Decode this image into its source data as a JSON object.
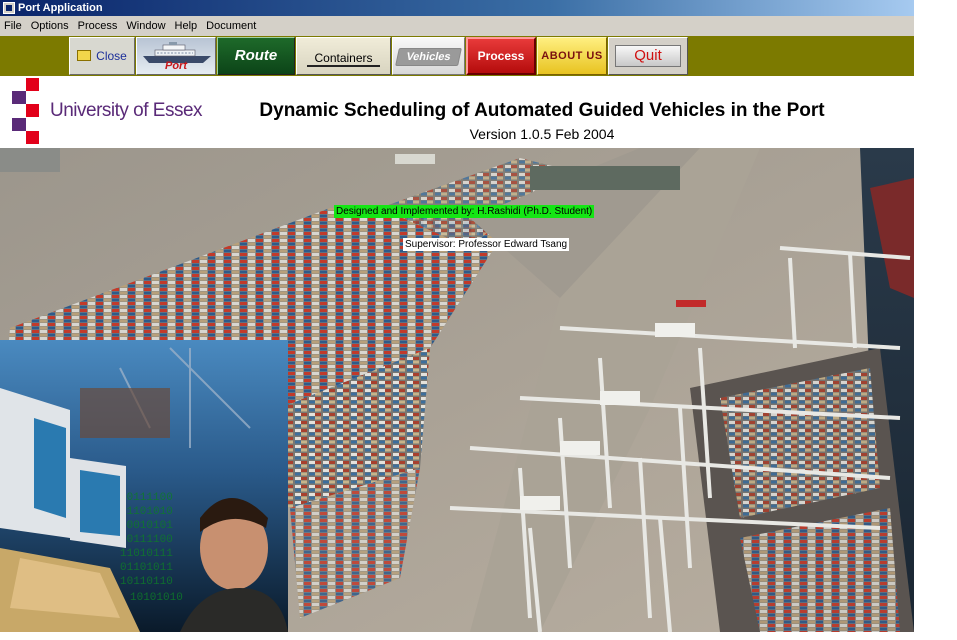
{
  "window": {
    "title": "Port Application"
  },
  "menu": [
    "File",
    "Options",
    "Process",
    "Window",
    "Help",
    "Document"
  ],
  "toolbar": {
    "close": "Close",
    "port": "Port",
    "route": "Route",
    "containers": "Containers",
    "vehicles": "Vehicles",
    "process": "Process",
    "about": "ABOUT US",
    "quit": "Quit"
  },
  "header": {
    "university": "University of Essex",
    "title": "Dynamic Scheduling of Automated Guided Vehicles in the Port",
    "version": "Version 1.0.5  Feb 2004"
  },
  "credits": {
    "designed": "Designed and Implemented by:  H.Rashidi  (Ph.D. Student)",
    "supervisor": "Supervisor: Professor Edward Tsang"
  },
  "colors": {
    "toolbar_bg": "#7c7a00",
    "essex_red": "#e2001a",
    "essex_purple": "#5a2a78",
    "credit_highlight": "#14e614"
  }
}
